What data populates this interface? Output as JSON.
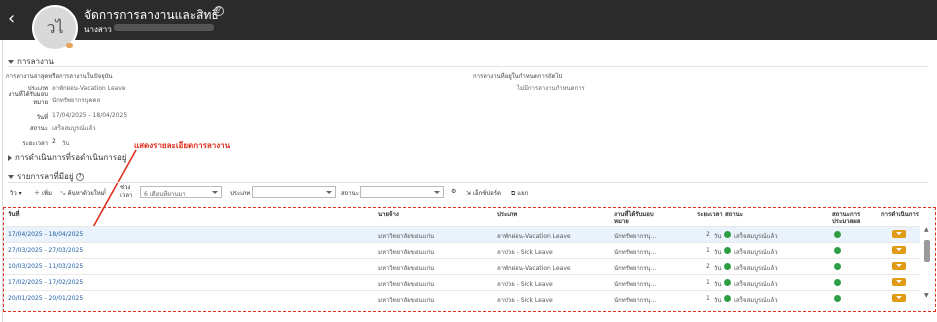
{
  "header": {
    "back_glyph": "‹",
    "avatar_initials": "วไ",
    "title": "จัดการการลางานและสิทธิ์",
    "help_glyph": "?",
    "name_prefix": "นางสาว"
  },
  "leave_section": {
    "title": "การลางาน",
    "current_heading": "การลางานล่าสุดหรือการลางานในปัจจุบัน",
    "next_heading": "การลางานที่อยู่ในกำหนดการถัดไป",
    "no_schedule": "ไม่มีการลางานกำหนดการ",
    "fields": {
      "type_label": "ประเภท",
      "type_value": "ลาพักผ่อน-Vacation Leave",
      "unit_label": "งานที่ได้รับมอบหมาย",
      "unit_value": "นักทรัพยากรบุคคล",
      "date_label": "วันที่",
      "date_value": "17/04/2025 - 18/04/2025",
      "status_label": "สถานะ",
      "status_value": "เสร็จสมบูรณ์แล้ว",
      "duration_label": "ระยะเวลา",
      "duration_value": "2",
      "duration_unit": "วัน"
    },
    "in_progress_title": "การดำเนินการที่รอดำเนินการอยู่"
  },
  "annotation": "แสดงรายละเอียดการลางาน",
  "list_section": {
    "title": "รายการลาที่มีอยู่",
    "toolbar": {
      "view_label": "วิว",
      "add_label": "เพิ่ม",
      "query_label": "ค้นหาด้วยใหม่",
      "period_label": "ช่วงเวลา",
      "period_value": "6 เดือนที่ผ่านมา",
      "type_label": "ประเภท",
      "type_value": "",
      "status_label": "สถานะ",
      "status_value": "",
      "export_label": "เอ็กซ์ปอร์ต",
      "detach_label": "แยก"
    },
    "columns": {
      "date": "วันที่",
      "employer": "นายจ้าง",
      "type": "ประเภท",
      "assignment": "งานที่ได้รับมอบหมาย",
      "duration": "ระยะเวลา",
      "status": "สถานะ",
      "approval": "สถานะการประมวลผล",
      "actions": "การดำเนินการ"
    },
    "rows": [
      {
        "date": "17/04/2025 - 18/04/2025",
        "employer": "มหาวิทยาลัยขอนแก่น",
        "type": "ลาพักผ่อน-Vacation Leave",
        "assignment": "นักทรัพยากรบุ...",
        "duration": "2",
        "unit": "วัน",
        "status": "เสร็จสมบูรณ์แล้ว"
      },
      {
        "date": "27/03/2025 - 27/03/2025",
        "employer": "มหาวิทยาลัยขอนแก่น",
        "type": "ลาป่วย - Sick Leave",
        "assignment": "นักทรัพยากรบุ...",
        "duration": "1",
        "unit": "วัน",
        "status": "เสร็จสมบูรณ์แล้ว"
      },
      {
        "date": "10/03/2025 - 11/03/2025",
        "employer": "มหาวิทยาลัยขอนแก่น",
        "type": "ลาพักผ่อน-Vacation Leave",
        "assignment": "นักทรัพยากรบุ...",
        "duration": "2",
        "unit": "วัน",
        "status": "เสร็จสมบูรณ์แล้ว"
      },
      {
        "date": "17/02/2025 - 17/02/2025",
        "employer": "มหาวิทยาลัยขอนแก่น",
        "type": "ลาป่วย - Sick Leave",
        "assignment": "นักทรัพยากรบุ...",
        "duration": "1",
        "unit": "วัน",
        "status": "เสร็จสมบูรณ์แล้ว"
      },
      {
        "date": "20/01/2025 - 20/01/2025",
        "employer": "มหาวิทยาลัยขอนแก่น",
        "type": "ลาป่วย - Sick Leave",
        "assignment": "นักทรัพยากรบุ...",
        "duration": "1",
        "unit": "วัน",
        "status": "เสร็จสมบูรณ์แล้ว"
      }
    ]
  },
  "colors": {
    "header_bg": "#2b2b2b",
    "annotation_red": "#e0301e",
    "link_blue": "#1f5fa8",
    "status_green": "#2e9e45",
    "action_orange": "#e09b14"
  }
}
